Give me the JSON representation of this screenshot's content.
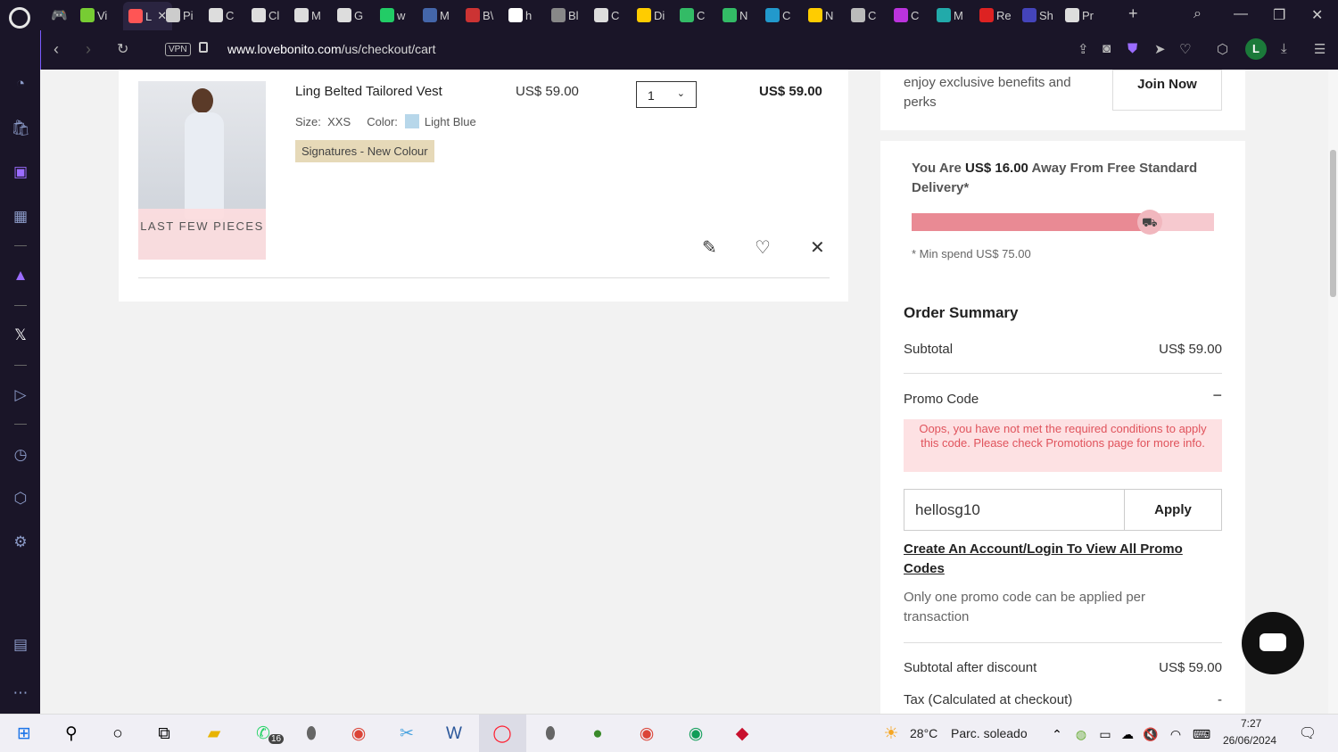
{
  "browser": {
    "url_host": "www.lovebonito.com",
    "url_path": "/us/checkout/cart",
    "vpn_label": "VPN",
    "tabs": [
      "Vi",
      "L",
      "Pi",
      "C",
      "Cl",
      "M",
      "G",
      "w",
      "M",
      "B\\",
      "h",
      "Bl",
      "C",
      "Di",
      "C",
      "N",
      "C",
      "N",
      "C",
      "C",
      "M",
      "Re",
      "Sh",
      "Pr"
    ],
    "profile_initial": "L"
  },
  "cart": {
    "item": {
      "name": "Ling Belted Tailored Vest",
      "unit_price": "US$ 59.00",
      "qty": "1",
      "total": "US$ 59.00",
      "size_label": "Size:",
      "size_value": "XXS",
      "color_label": "Color:",
      "color_value": "Light Blue",
      "color_hex": "#b7d7ea",
      "tag": "Signatures - New Colour",
      "stock_badge": "LAST FEW PIECES"
    }
  },
  "membership": {
    "text": "enjoy exclusive benefits and perks",
    "button": "Join Now"
  },
  "summary": {
    "free_delivery_prefix": "You Are ",
    "free_delivery_amount": "US$ 16.00",
    "free_delivery_suffix": " Away From Free Standard Delivery*",
    "progress_fraction": 0.787,
    "min_spend": "* Min spend US$ 75.00",
    "title": "Order Summary",
    "subtotal_label": "Subtotal",
    "subtotal_value": "US$ 59.00",
    "promo_label": "Promo Code",
    "promo_toggle": "−",
    "promo_error": "Oops, you have not met the required conditions to apply this code. Please check Promotions page for more info.",
    "promo_input_value": "hellosg10",
    "apply_label": "Apply",
    "login_link": "Create An Account/Login To View All Promo Codes",
    "note": "Only one promo code can be applied per transaction",
    "after_discount_label": "Subtotal after discount",
    "after_discount_value": "US$ 59.00",
    "tax_label": "Tax (Calculated at checkout)",
    "tax_value": "-"
  },
  "taskbar": {
    "temperature": "28°C",
    "weather": "Parc. soleado",
    "time": "7:27",
    "date": "26/06/2024",
    "whatsapp_badge": "16"
  },
  "colors": {
    "progress_fill": "#e98a94",
    "progress_track": "#f6c9cf",
    "error_text": "#e0535c",
    "error_bg": "#fde1e3"
  }
}
